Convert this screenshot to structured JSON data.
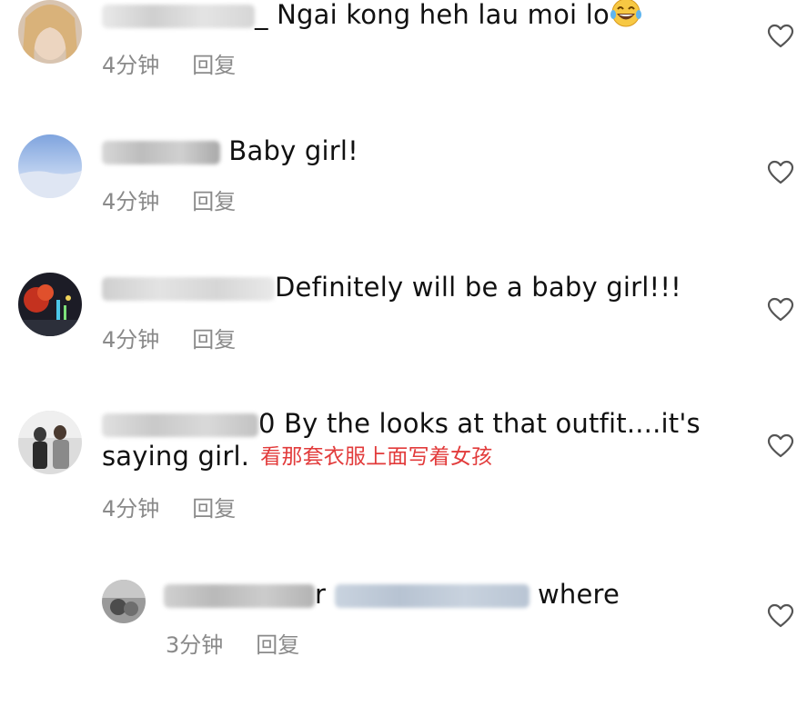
{
  "comments": [
    {
      "text": "_ Ngai kong heh lau moi lo",
      "time": "4分钟",
      "reply": "回复"
    },
    {
      "text": "Baby girl!",
      "time": "4分钟",
      "reply": "回复"
    },
    {
      "text": "Definitely will be a  baby girl!!!",
      "time": "4分钟",
      "reply": "回复"
    },
    {
      "text_line1": "0 By the looks at that outfit....it's",
      "text_line2": "saying girl.",
      "annotation": "看那套衣服上面写着女孩",
      "time": "4分钟",
      "reply": "回复"
    },
    {
      "username_tail": "r",
      "text": "where",
      "time": "3分钟",
      "reply": "回复"
    }
  ],
  "icons": [
    "heart-icon",
    "laughing-emoji-icon"
  ],
  "colors": {
    "meta_gray": "#8a8a8a",
    "annotation_red": "#e23b3b"
  }
}
